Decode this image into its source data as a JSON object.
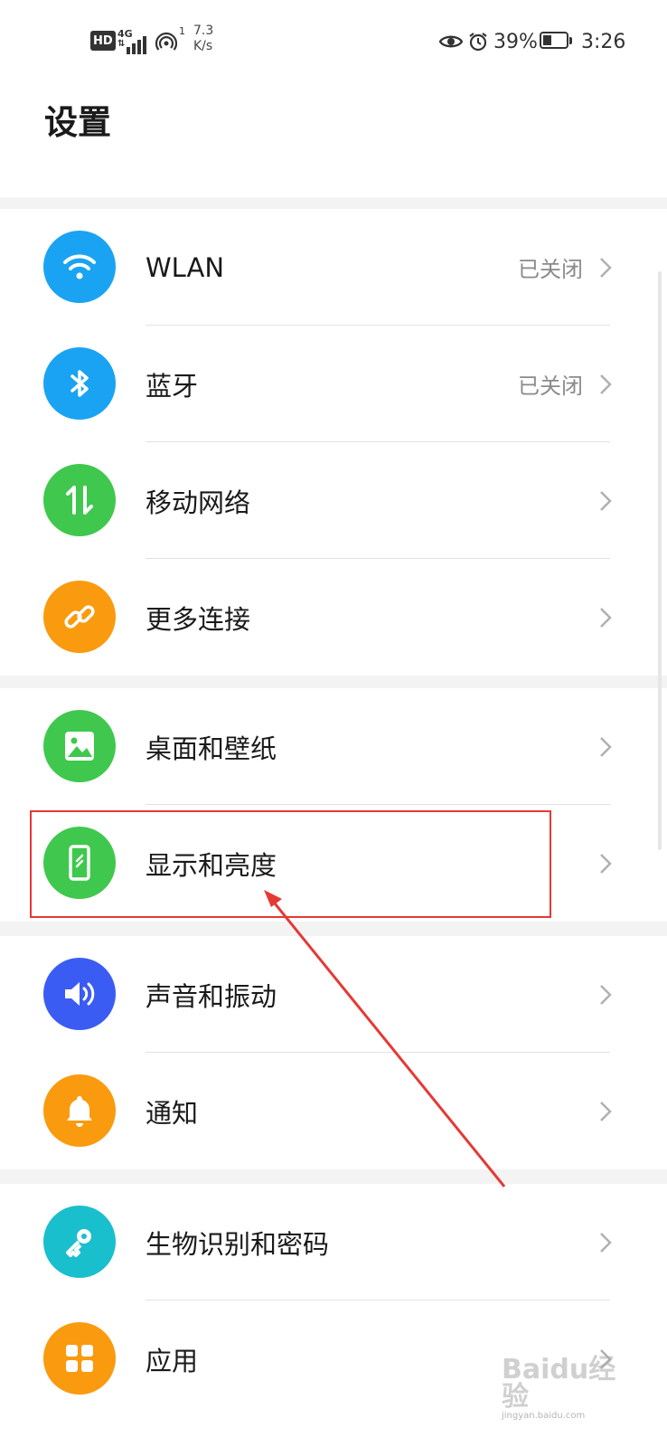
{
  "status_bar": {
    "hd": "HD",
    "network": "4G",
    "hotspot_count": "1",
    "speed_value": "7.3",
    "speed_unit": "K/s",
    "battery_pct": "39%",
    "battery_level": 0.39,
    "time": "3:26"
  },
  "page_title": "设置",
  "groups": [
    {
      "items": [
        {
          "label": "WLAN",
          "value": "已关闭",
          "icon": "wifi-icon",
          "color": "#1aa3f2"
        },
        {
          "label": "蓝牙",
          "value": "已关闭",
          "icon": "bluetooth-icon",
          "color": "#1aa3f2"
        },
        {
          "label": "移动网络",
          "value": "",
          "icon": "mobile-data-icon",
          "color": "#3fc84d"
        },
        {
          "label": "更多连接",
          "value": "",
          "icon": "link-icon",
          "color": "#fa9a0e"
        }
      ]
    },
    {
      "items": [
        {
          "label": "桌面和壁纸",
          "value": "",
          "icon": "wallpaper-icon",
          "color": "#3fc84d"
        },
        {
          "label": "显示和亮度",
          "value": "",
          "icon": "display-icon",
          "color": "#3fc84d"
        }
      ]
    },
    {
      "items": [
        {
          "label": "声音和振动",
          "value": "",
          "icon": "volume-icon",
          "color": "#3b5cf3"
        },
        {
          "label": "通知",
          "value": "",
          "icon": "bell-icon",
          "color": "#fa9a0e"
        }
      ]
    },
    {
      "items": [
        {
          "label": "生物识别和密码",
          "value": "",
          "icon": "key-icon",
          "color": "#19bfcc"
        },
        {
          "label": "应用",
          "value": "",
          "icon": "apps-icon",
          "color": "#fa9a0e"
        }
      ]
    }
  ],
  "watermark": {
    "brand": "Baidu经验",
    "url": "jingyan.baidu.com"
  }
}
